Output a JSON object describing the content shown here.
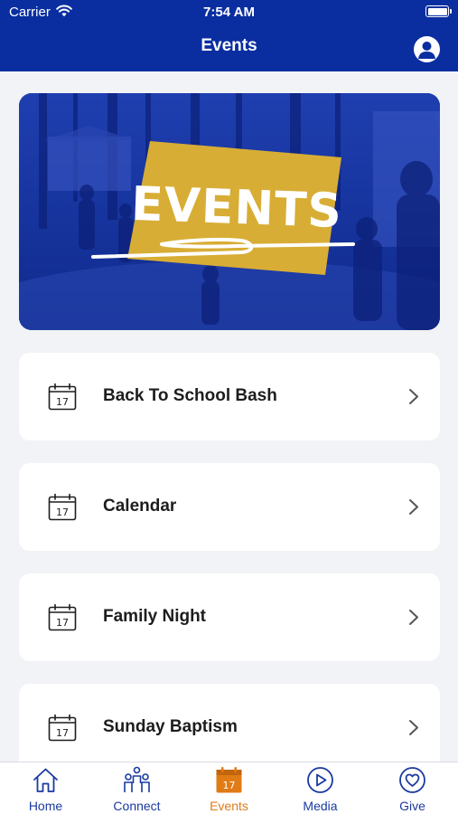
{
  "status_bar": {
    "carrier": "Carrier",
    "time": "7:54 AM"
  },
  "header": {
    "title": "Events"
  },
  "banner": {
    "text": "EVENTS"
  },
  "events": [
    {
      "label": "Back To School Bash",
      "calendar_day": "17"
    },
    {
      "label": "Calendar",
      "calendar_day": "17"
    },
    {
      "label": "Family Night",
      "calendar_day": "17"
    },
    {
      "label": "Sunday Baptism",
      "calendar_day": "17"
    }
  ],
  "tabs": [
    {
      "label": "Home",
      "icon": "home-icon"
    },
    {
      "label": "Connect",
      "icon": "people-icon"
    },
    {
      "label": "Events",
      "icon": "calendar-icon",
      "active": true,
      "badge_day": "17"
    },
    {
      "label": "Media",
      "icon": "play-icon"
    },
    {
      "label": "Give",
      "icon": "heart-icon"
    }
  ],
  "colors": {
    "header": "#0a2ea0",
    "tab_inactive": "#1a3aa0",
    "tab_active": "#e07b16",
    "banner_sign": "#d8ad35"
  }
}
